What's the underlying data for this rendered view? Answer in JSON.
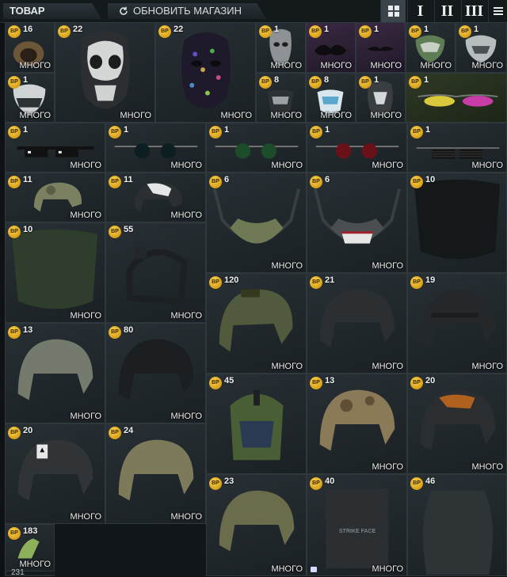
{
  "header": {
    "goods_tab": "ТОВАР",
    "refresh_button": "ОБНОВИТЬ МАГАЗИН",
    "view_modes": [
      "I",
      "II",
      "III"
    ]
  },
  "badge_label": "BP",
  "many_label": "МНОГО",
  "items": [
    {
      "id": "hood-brown",
      "qty": "16"
    },
    {
      "id": "skull-mask",
      "qty": "22"
    },
    {
      "id": "pattern-mask",
      "qty": "22"
    },
    {
      "id": "dark-face-mask",
      "qty": "1"
    },
    {
      "id": "black-mustache",
      "qty": "1"
    },
    {
      "id": "thin-mustache",
      "qty": "1"
    },
    {
      "id": "camo-mask",
      "qty": "1"
    },
    {
      "id": "white-skull-mask",
      "qty": "1"
    },
    {
      "id": "ghost-mask",
      "qty": "1"
    },
    {
      "id": "skull-halfmask",
      "qty": "8"
    },
    {
      "id": "ice-halfmask",
      "qty": "8"
    },
    {
      "id": "punisher-mask",
      "qty": "1"
    },
    {
      "id": "pink-sunglasses",
      "qty": "1"
    },
    {
      "id": "pixel-sunglasses",
      "qty": "1"
    },
    {
      "id": "round-sunglasses-black",
      "qty": "1"
    },
    {
      "id": "round-sunglasses-green",
      "qty": "1"
    },
    {
      "id": "round-sunglasses-red",
      "qty": "1"
    },
    {
      "id": "shutter-glasses",
      "qty": "1"
    },
    {
      "id": "camo-cap",
      "qty": "11"
    },
    {
      "id": "arctic-cap",
      "qty": "11"
    },
    {
      "id": "camo-jaw-guard",
      "qty": "6"
    },
    {
      "id": "teeth-jaw-guard",
      "qty": "6"
    },
    {
      "id": "black-visor",
      "qty": "10"
    },
    {
      "id": "green-visor",
      "qty": "10"
    },
    {
      "id": "nvg-frame",
      "qty": "55"
    },
    {
      "id": "green-helmet",
      "qty": "120"
    },
    {
      "id": "black-helmet-a",
      "qty": "21"
    },
    {
      "id": "black-helmet-b",
      "qty": "19"
    },
    {
      "id": "grey-helmet",
      "qty": "13"
    },
    {
      "id": "black-helmet-c",
      "qty": "80"
    },
    {
      "id": "green-tactical-helmet",
      "qty": "45"
    },
    {
      "id": "camo-helmet",
      "qty": "13"
    },
    {
      "id": "orange-helmet",
      "qty": "20"
    },
    {
      "id": "ace-helmet",
      "qty": "20"
    },
    {
      "id": "desert-helmet",
      "qty": "24"
    },
    {
      "id": "olive-helmet",
      "qty": "23"
    },
    {
      "id": "strike-face-plate",
      "qty": "40",
      "plate_text": "STRIKE FACE"
    },
    {
      "id": "ceramic-plate",
      "qty": "46"
    },
    {
      "id": "green-gloves",
      "qty": "183"
    }
  ],
  "footer_count": "231"
}
